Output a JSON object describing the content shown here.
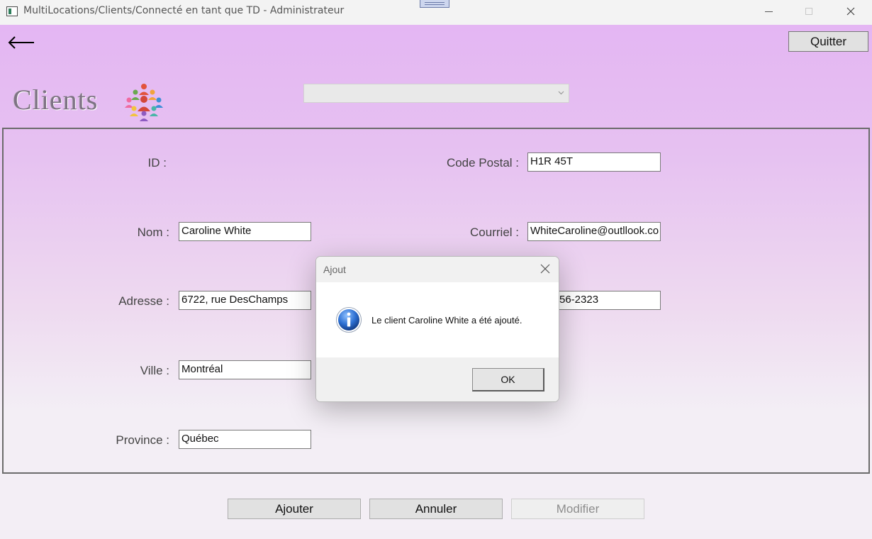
{
  "window": {
    "title": "MultiLocations/Clients/Connecté en tant que TD - Administrateur"
  },
  "header": {
    "quit_label": "Quitter",
    "page_title": "Clients",
    "combo_value": ""
  },
  "form": {
    "id_label": "ID :",
    "id_value": "",
    "nom_label": "Nom :",
    "nom_value": "Caroline White",
    "adresse_label": "Adresse :",
    "adresse_value": "6722, rue DesChamps",
    "ville_label": "Ville :",
    "ville_value": "Montréal",
    "province_label": "Province :",
    "province_value": "Québec",
    "code_postal_label": "Code Postal :",
    "code_postal_value": "H1R 45T",
    "courriel_label": "Courriel :",
    "courriel_value": "WhiteCaroline@outllook.co",
    "telephone_value": "56-2323"
  },
  "actions": {
    "add_label": "Ajouter",
    "cancel_label": "Annuler",
    "modify_label": "Modifier"
  },
  "dialog": {
    "title": "Ajout",
    "message": "Le client Caroline White a été ajouté.",
    "ok_label": "OK",
    "icon": "info-icon"
  },
  "colors": {
    "gradient_top": "#e4b6f3",
    "background": "#f3eef5",
    "button_face": "#e1e1e1",
    "info_blue": "#1f5fbf"
  }
}
